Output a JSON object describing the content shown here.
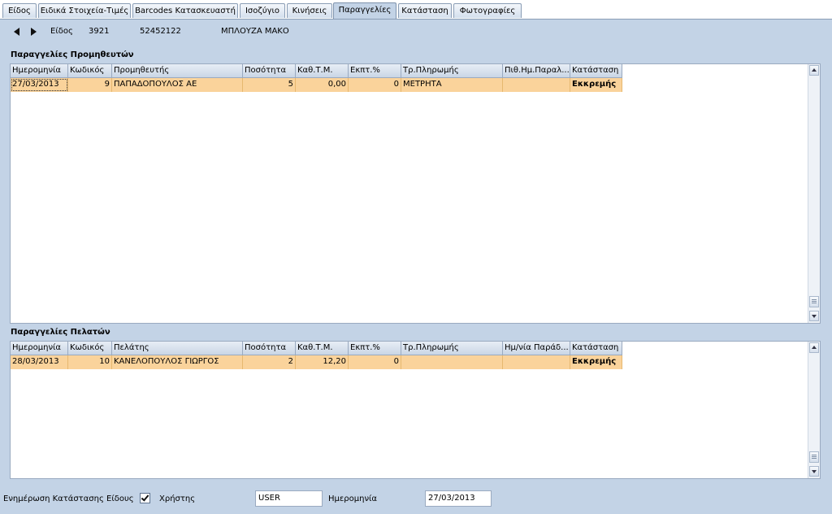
{
  "tabs": [
    {
      "label": "Είδος"
    },
    {
      "label": "Ειδικά Στοιχεία-Τιμές"
    },
    {
      "label": "Barcodes Κατασκευαστή"
    },
    {
      "label": "Ισοζύγιο"
    },
    {
      "label": "Κινήσεις"
    },
    {
      "label": "Παραγγελίες"
    },
    {
      "label": "Κατάσταση"
    },
    {
      "label": "Φωτογραφίες"
    }
  ],
  "active_tab": "Παραγγελίες",
  "item": {
    "label": "Είδος",
    "code": "3921",
    "barcode": "52452122",
    "description": "ΜΠΛΟΥΖΑ ΜΑΚΟ"
  },
  "supplier_orders": {
    "title": "Παραγγελίες Προμηθευτών",
    "columns": [
      "Ημερομηνία",
      "Κωδικός",
      "Προμηθευτής",
      "Ποσότητα",
      "Καθ.Τ.Μ.",
      "Εκπτ.%",
      "Τρ.Πληρωμής",
      "Πιθ.Ημ.Παραλ...",
      "Κατάσταση"
    ],
    "rows": [
      {
        "date": "27/03/2013",
        "code": "9",
        "name": "ΠΑΠΑΔΟΠΟΥΛΟΣ ΑΕ",
        "qty": "5",
        "price": "0,00",
        "discount": "0",
        "payment": "ΜΕΤΡΗΤΑ",
        "delivery": "",
        "status": "Εκκρεμής"
      }
    ]
  },
  "customer_orders": {
    "title": "Παραγγελίες Πελατών",
    "columns": [
      "Ημερομηνία",
      "Κωδικός",
      "Πελάτης",
      "Ποσότητα",
      "Καθ.Τ.Μ.",
      "Εκπτ.%",
      "Τρ.Πληρωμής",
      "Ημ/νία Παράδ...",
      "Κατάσταση"
    ],
    "rows": [
      {
        "date": "28/03/2013",
        "code": "10",
        "name": "ΚΑΝΕΛΟΠΟΥΛΟΣ ΓΙΩΡΓΟΣ",
        "qty": "2",
        "price": "12,20",
        "discount": "0",
        "payment": "",
        "delivery": "",
        "status": "Εκκρεμής"
      }
    ]
  },
  "footer": {
    "update_label": "Ενημέρωση Κατάστασης Είδους",
    "checkbox_checked": true,
    "user_label": "Χρήστης",
    "user_value": "USER",
    "date_label": "Ημερομηνία",
    "date_value": "27/03/2013"
  },
  "colors": {
    "background": "#c3d3e6",
    "row_highlight": "#fad39b"
  }
}
